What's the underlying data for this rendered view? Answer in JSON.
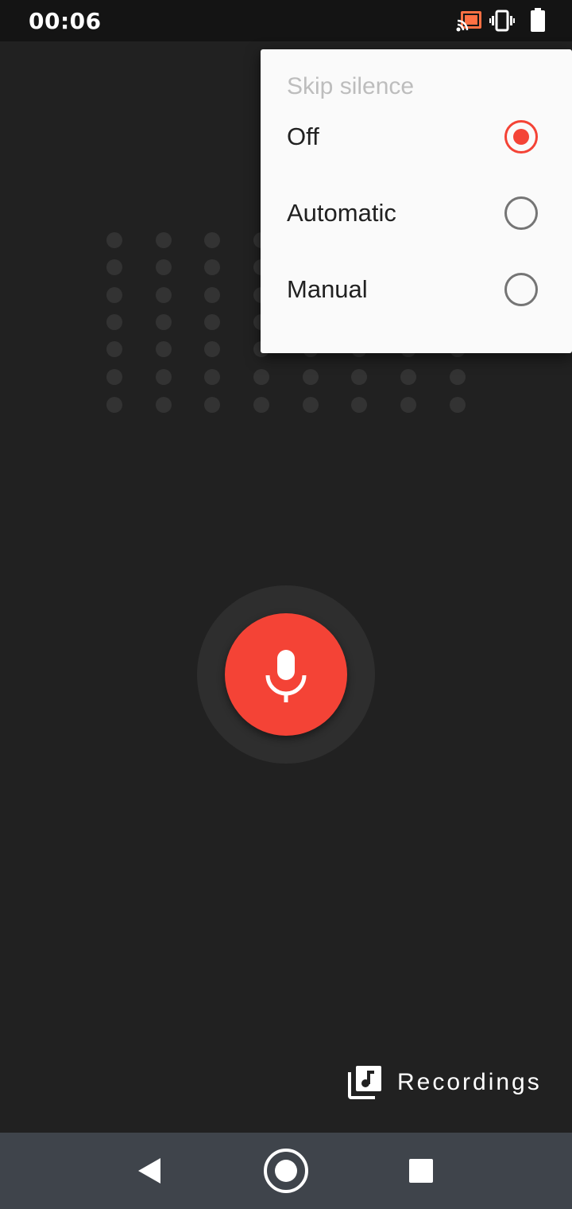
{
  "status_bar": {
    "time": "00:06",
    "icons": [
      "cast-icon",
      "vibrate-icon",
      "battery-icon"
    ],
    "cast_color": "#ff7043"
  },
  "recorder": {
    "mic_icon": "mic-icon",
    "mic_color": "#f44336"
  },
  "recordings": {
    "label": "Recordings",
    "icon": "library-music-icon"
  },
  "skip_silence_menu": {
    "title": "Skip silence",
    "options": [
      {
        "label": "Off",
        "selected": true
      },
      {
        "label": "Automatic",
        "selected": false
      },
      {
        "label": "Manual",
        "selected": false
      }
    ],
    "accent_color": "#f44336"
  },
  "nav_bar": {
    "icons": [
      "back-icon",
      "home-icon",
      "recents-icon"
    ]
  }
}
